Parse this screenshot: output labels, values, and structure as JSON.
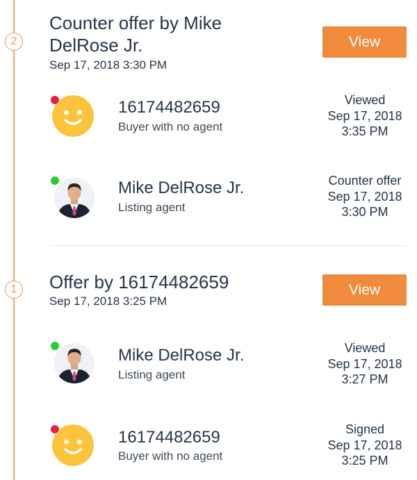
{
  "offers": [
    {
      "step": "2",
      "title_line1": "Counter offer by Mike",
      "title_line2": "DelRose Jr.",
      "date": "Sep 17, 2018 3:30 PM",
      "button_label": "View",
      "parties": [
        {
          "avatar": "smiley-face-icon",
          "status_color": "#e8213c",
          "name": "16174482659",
          "role": "Buyer with no agent",
          "action": "Viewed",
          "action_date": "Sep 17, 2018",
          "action_time": "3:35 PM"
        },
        {
          "avatar": "agent-photo",
          "status_color": "#28cc35",
          "name": "Mike DelRose Jr.",
          "role": "Listing agent",
          "action": "Counter offer",
          "action_date": "Sep 17, 2018",
          "action_time": "3:30 PM"
        }
      ]
    },
    {
      "step": "1",
      "title_line1": "Offer by 16174482659",
      "date": "Sep 17, 2018 3:25 PM",
      "button_label": "View",
      "parties": [
        {
          "avatar": "agent-photo",
          "status_color": "#28cc35",
          "name": "Mike DelRose Jr.",
          "role": "Listing agent",
          "action": "Viewed",
          "action_date": "Sep 17, 2018",
          "action_time": "3:27 PM"
        },
        {
          "avatar": "smiley-face-icon",
          "status_color": "#e8213c",
          "name": "16174482659",
          "role": "Buyer with no agent",
          "action": "Signed",
          "action_date": "Sep 17, 2018",
          "action_time": "3:25 PM"
        }
      ]
    }
  ],
  "colors": {
    "accent": "#f08a3c",
    "timeline": "#f0a860",
    "text": "#243447",
    "online": "#28cc35",
    "offline": "#e8213c",
    "emoji": "#fcc43d"
  }
}
